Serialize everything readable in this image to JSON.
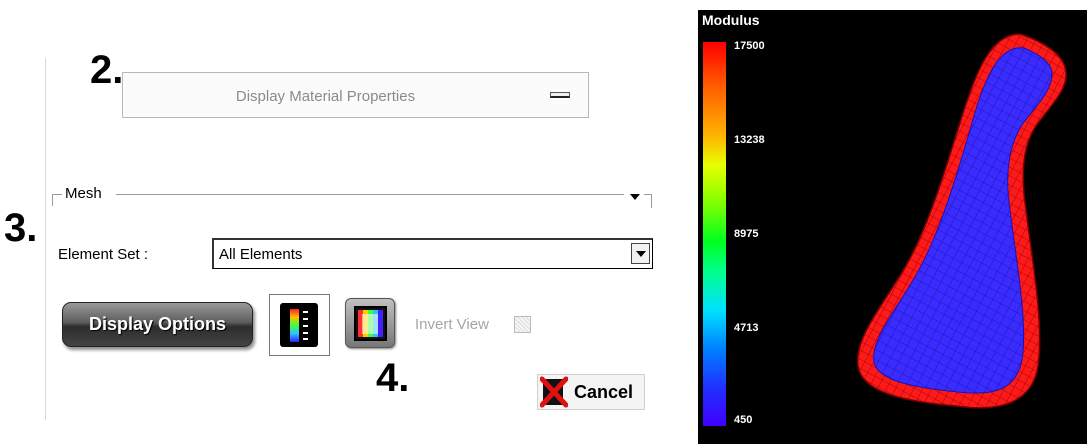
{
  "step_labels": {
    "step2": "2.",
    "step3": "3.",
    "step4": "4."
  },
  "material_button": {
    "label": "Display Material Properties"
  },
  "mesh_group": {
    "title": "Mesh"
  },
  "element_set": {
    "label": "Element Set :",
    "value": "All Elements"
  },
  "display_options": {
    "label": "Display Options"
  },
  "invert_view": {
    "label": "Invert View",
    "checked": false
  },
  "cancel": {
    "label": "Cancel"
  },
  "icons": {
    "colorbar_toggle": "colorbar-icon",
    "view_toggle": "color-view-icon",
    "cancel": "red-x-icon"
  },
  "legend": {
    "title": "Modulus",
    "ticks": [
      "17500",
      "13238",
      "8975",
      "4713",
      "450"
    ]
  },
  "colors": {
    "mesh_inner": "#3a2cff",
    "mesh_boundary": "#ff1a1a",
    "viewer_background": "#000000"
  }
}
